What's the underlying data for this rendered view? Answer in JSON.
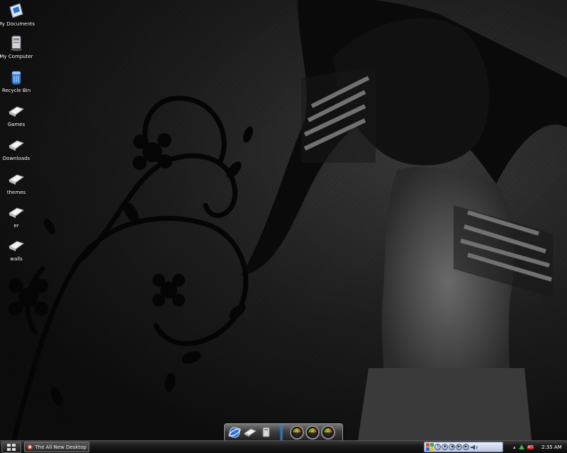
{
  "desktop": {
    "icons": [
      {
        "label": "My Documents",
        "icon": "my-documents-icon"
      },
      {
        "label": "My Computer",
        "icon": "my-computer-icon"
      },
      {
        "label": "Recycle Bin",
        "icon": "recycle-bin-icon"
      },
      {
        "label": "Games",
        "icon": "folder-icon"
      },
      {
        "label": "Downloads",
        "icon": "folder-icon"
      },
      {
        "label": "themes",
        "icon": "folder-icon"
      },
      {
        "label": "er",
        "icon": "folder-icon"
      },
      {
        "label": "walls",
        "icon": "folder-icon"
      }
    ],
    "wallpaper": "dark floral vine wallpaper with figure"
  },
  "dock": {
    "items": [
      "browser-icon",
      "folder-icon",
      "computer-icon"
    ],
    "gauges": [
      {
        "name": "cpu-gauge",
        "label": ""
      },
      {
        "name": "ram-gauge",
        "label": ""
      },
      {
        "name": "disk-gauge",
        "label": ""
      }
    ]
  },
  "taskbar": {
    "start_icon": "start-menu-icon",
    "task_label": "The All New Desktop ...",
    "media_controls": [
      "windows-logo-icon",
      "pause-icon",
      "stop-icon",
      "previous-icon",
      "play-icon",
      "next-icon",
      "volume-icon"
    ],
    "tray_icons": [
      "tray-arrow-icon",
      "network-icon",
      "ati-icon"
    ],
    "tray_text": "ATI",
    "clock": "2:35 AM"
  },
  "colors": {
    "dock_separator": "#1a7be0",
    "media_bar": "#b8c4dc",
    "tray_green": "#3cb83c",
    "tray_red": "#d22020"
  }
}
